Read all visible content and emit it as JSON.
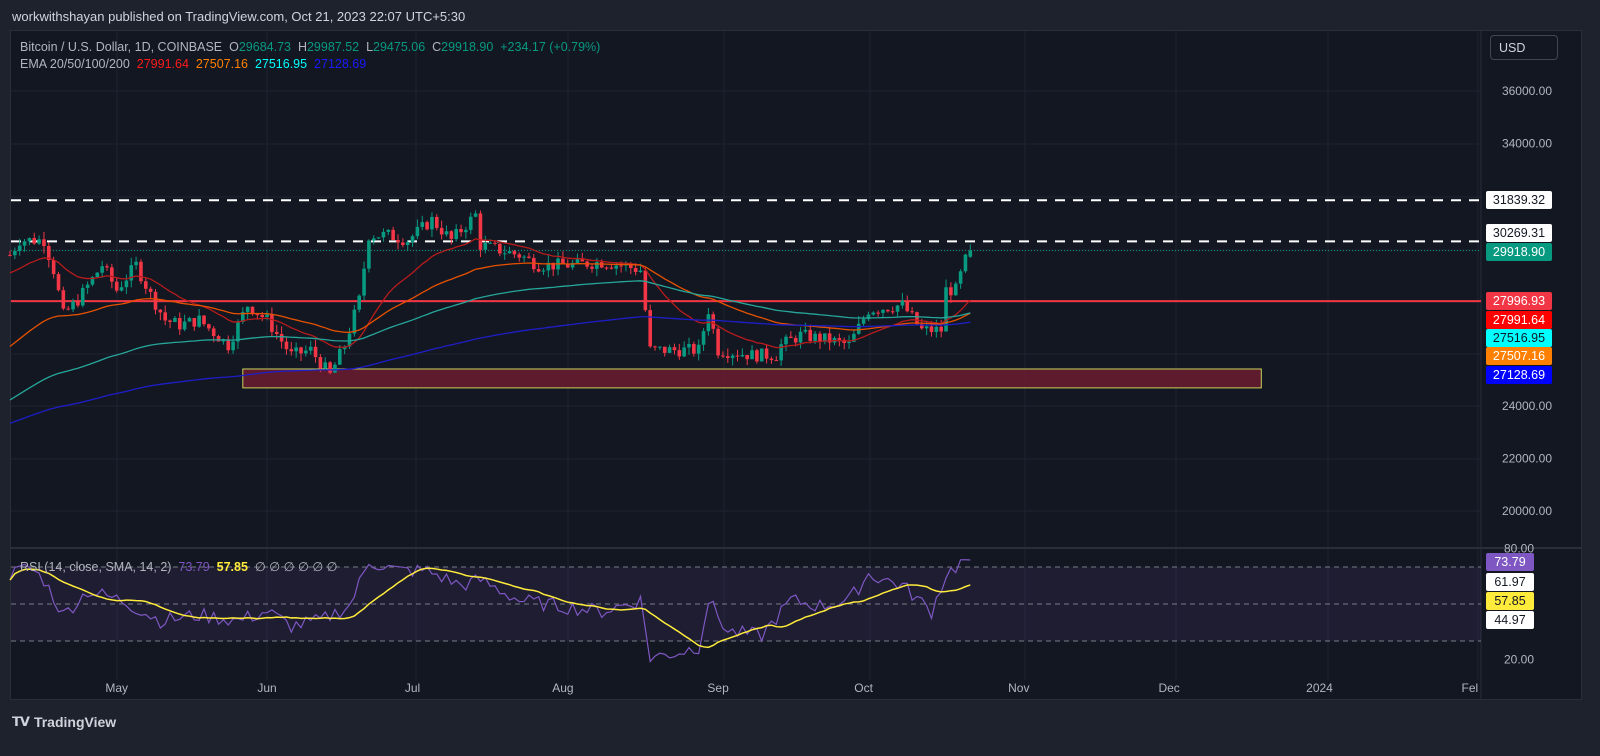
{
  "header": {
    "published": "workwithshayan published on TradingView.com, Oct 21, 2023 22:07 UTC+5:30"
  },
  "legend": {
    "symbol": "Bitcoin / U.S. Dollar, 1D, COINBASE",
    "o_label": "O",
    "o": "29684.73",
    "h_label": "H",
    "h": "29987.52",
    "l_label": "L",
    "l": "29475.06",
    "c_label": "C",
    "c": "29918.90",
    "change": "+234.17 (+0.79%)",
    "ema_label": "EMA 20/50/100/200",
    "ema20": "27991.64",
    "ema50": "27507.16",
    "ema100": "27516.95",
    "ema200": "27128.69"
  },
  "rsi_legend": {
    "label": "RSI (14, close, SMA, 14, 2)",
    "rsi": "73.79",
    "sma": "57.85",
    "extras": "∅ ∅ ∅ ∅ ∅ ∅"
  },
  "currency_button": "USD",
  "colors": {
    "up": "#089981",
    "down": "#f23645",
    "ema20": "#b71c1c",
    "ema50": "#e65100",
    "ema100": "#26a69a",
    "ema200": "#1e1ec8",
    "rsi": "#7e57c2",
    "rsi_sma": "#ffeb3b"
  },
  "price_tags": [
    {
      "text": "31839.32",
      "value": 31839.32,
      "bg": "#ffffff",
      "fg": "#131722"
    },
    {
      "text": "30269.31",
      "value": 30269.31,
      "bg": "#ffffff",
      "fg": "#131722"
    },
    {
      "text": "29918.90",
      "value": 29918.9,
      "bg": "#089981",
      "fg": "#ffffff"
    },
    {
      "text": "27996.93",
      "value": 27996.93,
      "bg": "#f23645",
      "fg": "#ffffff"
    },
    {
      "text": "27991.64",
      "value": 27991.64,
      "bg": "#ff0000",
      "fg": "#ffffff"
    },
    {
      "text": "27516.95",
      "value": 27516.95,
      "bg": "#00ffff",
      "fg": "#131722"
    },
    {
      "text": "27507.16",
      "value": 27507.16,
      "bg": "#ff8000",
      "fg": "#ffffff"
    },
    {
      "text": "27128.69",
      "value": 27128.69,
      "bg": "#0000ff",
      "fg": "#ffffff"
    }
  ],
  "rsi_tags": [
    {
      "text": "73.79",
      "bg": "#7e57c2",
      "fg": "#ffffff"
    },
    {
      "text": "61.97",
      "bg": "#ffffff",
      "fg": "#131722"
    },
    {
      "text": "57.85",
      "bg": "#ffeb3b",
      "fg": "#131722"
    },
    {
      "text": "44.97",
      "bg": "#ffffff",
      "fg": "#131722"
    }
  ],
  "footer": {
    "brand": "TradingView"
  },
  "chart_data": {
    "type": "candlestick",
    "title": "Bitcoin / U.S. Dollar, 1D, COINBASE",
    "price_axis": {
      "ticks": [
        36000,
        34000,
        32000,
        30000,
        28000,
        26000,
        24000,
        22000,
        20000
      ],
      "tick_labels": [
        "36000.00",
        "34000.00",
        "",
        "",
        "",
        "",
        "24000.00",
        "22000.00",
        "20000.00"
      ],
      "range": [
        18500,
        37500
      ]
    },
    "rsi_axis": {
      "ticks": [
        80,
        20
      ],
      "tick_labels": [
        "80.00",
        "20.00"
      ],
      "bands": [
        70,
        50,
        30
      ]
    },
    "time_axis": {
      "labels": [
        "May",
        "Jun",
        "Jul",
        "Aug",
        "Sep",
        "Oct",
        "Nov",
        "Dec",
        "2024",
        "Fel"
      ],
      "label_days": [
        22,
        53,
        83,
        114,
        146,
        176,
        208,
        239,
        270,
        301
      ]
    },
    "close_anchors": [
      [
        0,
        29750
      ],
      [
        2,
        30320
      ],
      [
        7,
        30320
      ],
      [
        9,
        29180
      ],
      [
        11,
        27470
      ],
      [
        14,
        28040
      ],
      [
        19,
        29370
      ],
      [
        22,
        28420
      ],
      [
        26,
        29370
      ],
      [
        29,
        28230
      ],
      [
        32,
        27280
      ],
      [
        35,
        27090
      ],
      [
        39,
        27280
      ],
      [
        45,
        26320
      ],
      [
        49,
        27850
      ],
      [
        53,
        27280
      ],
      [
        58,
        25940
      ],
      [
        62,
        26130
      ],
      [
        66,
        25180
      ],
      [
        69,
        26320
      ],
      [
        72,
        28040
      ],
      [
        74,
        30510
      ],
      [
        78,
        30510
      ],
      [
        82,
        30320
      ],
      [
        87,
        31090
      ],
      [
        91,
        30320
      ],
      [
        96,
        31280
      ],
      [
        97,
        30130
      ],
      [
        105,
        29750
      ],
      [
        109,
        29370
      ],
      [
        115,
        29370
      ],
      [
        122,
        29480
      ],
      [
        126,
        29370
      ],
      [
        130,
        29180
      ],
      [
        132,
        26130
      ],
      [
        134,
        26130
      ],
      [
        142,
        26130
      ],
      [
        144,
        27660
      ],
      [
        146,
        26130
      ],
      [
        153,
        25940
      ],
      [
        158,
        25940
      ],
      [
        159,
        26320
      ],
      [
        163,
        26700
      ],
      [
        169,
        26510
      ],
      [
        173,
        26320
      ],
      [
        177,
        27660
      ],
      [
        184,
        27850
      ],
      [
        188,
        26890
      ],
      [
        192,
        26890
      ],
      [
        193,
        28420
      ],
      [
        195,
        28420
      ],
      [
        197,
        29560
      ],
      [
        198,
        29918.9
      ]
    ],
    "ema_seed": {
      "ema20": 29000,
      "ema50": 26130,
      "ema100": 24120,
      "ema200": 23280
    },
    "rsi_anchors": [
      [
        0,
        66
      ],
      [
        4,
        70
      ],
      [
        7,
        63
      ],
      [
        11,
        44
      ],
      [
        16,
        57
      ],
      [
        23,
        52
      ],
      [
        31,
        41
      ],
      [
        39,
        44
      ],
      [
        47,
        41
      ],
      [
        53,
        46
      ],
      [
        58,
        38
      ],
      [
        64,
        41
      ],
      [
        70,
        49
      ],
      [
        74,
        73
      ],
      [
        80,
        68
      ],
      [
        86,
        68
      ],
      [
        93,
        60
      ],
      [
        97,
        63
      ],
      [
        105,
        52
      ],
      [
        113,
        49
      ],
      [
        122,
        46
      ],
      [
        130,
        52
      ],
      [
        132,
        21
      ],
      [
        138,
        24
      ],
      [
        142,
        27
      ],
      [
        144,
        52
      ],
      [
        148,
        35
      ],
      [
        155,
        33
      ],
      [
        161,
        52
      ],
      [
        167,
        49
      ],
      [
        173,
        52
      ],
      [
        177,
        66
      ],
      [
        184,
        60
      ],
      [
        190,
        46
      ],
      [
        193,
        66
      ],
      [
        197,
        74
      ],
      [
        198,
        73.79
      ]
    ],
    "levels": [
      {
        "name": "resistance-high",
        "value": 31839.32,
        "style": "dashed"
      },
      {
        "name": "resistance-low",
        "value": 30269.31,
        "style": "dashed"
      },
      {
        "name": "pivot",
        "value": 27996.93,
        "style": "solid"
      }
    ],
    "support_zone": {
      "from_day": 48,
      "to_day": 258,
      "low": 24690,
      "high": 25410
    }
  }
}
